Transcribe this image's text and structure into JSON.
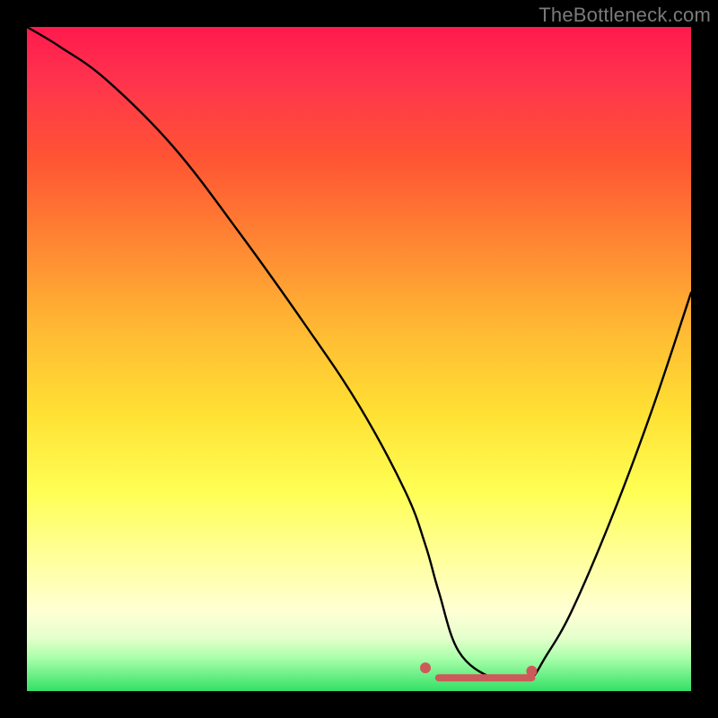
{
  "watermark": "TheBottleneck.com",
  "chart_data": {
    "type": "line",
    "title": "",
    "xlabel": "",
    "ylabel": "",
    "xlim": [
      0,
      100
    ],
    "ylim": [
      0,
      100
    ],
    "series": [
      {
        "name": "curve",
        "x": [
          0,
          5,
          12,
          22,
          32,
          42,
          50,
          57,
          60,
          62,
          65,
          70,
          74,
          76,
          78,
          82,
          88,
          94,
          100
        ],
        "values": [
          100,
          97,
          92,
          82,
          69,
          55,
          43,
          30,
          22,
          15,
          6,
          2,
          2,
          2,
          5,
          12,
          26,
          42,
          60
        ]
      }
    ],
    "markers": [
      {
        "name": "left-foot-dot",
        "x": 60,
        "y": 3.5,
        "color": "#cc5a5a",
        "r": 6
      },
      {
        "name": "right-foot-dot",
        "x": 76,
        "y": 3.0,
        "color": "#cc5a5a",
        "r": 6
      }
    ],
    "flat_segment": {
      "x_start": 62,
      "x_end": 76,
      "y": 2,
      "color": "#cc5a5a",
      "thickness": 8
    }
  }
}
